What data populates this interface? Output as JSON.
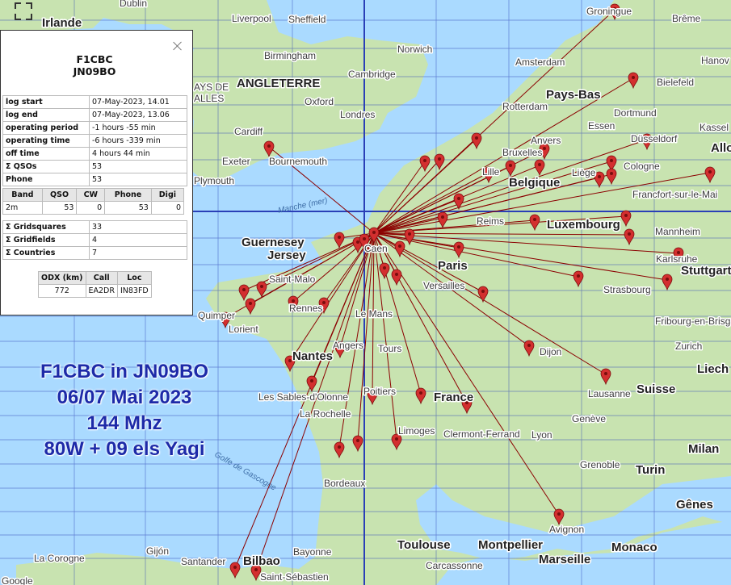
{
  "map": {
    "fullscreen_icon": "fullscreen-icon",
    "marker_color": "#d32f2f",
    "path_color": "#8b0000",
    "grid_color": "#2a3fb7",
    "home_marker": {
      "call": "F1CBC",
      "locator": "JN09BO"
    },
    "labels": {
      "countries": [
        "Pays-Bas",
        "Belgique",
        "Luxembourg",
        "France",
        "Suisse",
        "Monaco",
        "ANGLETERRE",
        "Guernesey",
        "Jersey"
      ],
      "cities": [
        "Dublin",
        "Irlande",
        "Liverpool",
        "Sheffield",
        "Birmingham",
        "Norwich",
        "Cambridge",
        "Oxford",
        "Londres",
        "Cardiff",
        "Exeter",
        "Plymouth",
        "Bournemouth",
        "Amsterdam",
        "Rotterdam",
        "Anvers",
        "Bruxelles",
        "Lille",
        "Liège",
        "Dortmund",
        "Essen",
        "Düsseldorf",
        "Cologne",
        "Bielefeld",
        "Groningue",
        "Brême",
        "Hanov",
        "Kassel",
        "Allo",
        "Francfort-sur-le-Mai",
        "Mannheim",
        "Karlsruhe",
        "Stuttgart",
        "Strasbourg",
        "Fribourg-en-Brisgau",
        "Zurich",
        "Liech",
        "Dijon",
        "Lausanne",
        "Genève",
        "Lyon",
        "Clermont-Ferrand",
        "Grenoble",
        "Turin",
        "Milan",
        "Gênes",
        "Avignon",
        "Marseille",
        "Montpellier",
        "Toulouse",
        "Carcassonne",
        "Bordeaux",
        "Limoges",
        "Poitiers",
        "La Rochelle",
        "Les Sables-d'Olonne",
        "Nantes",
        "Angers",
        "Tours",
        "Le Mans",
        "Rennes",
        "Saint-Malo",
        "Quimper",
        "Lorient",
        "Caen",
        "Paris",
        "Versailles",
        "Reims",
        "Bayonne",
        "Bilbao",
        "Santander",
        "Gijón",
        "La Corogne",
        "Saint-Sébastien",
        "Manche (mer)",
        "Golfe de Gascogne",
        "Google",
        "AYS DE",
        "ALLES"
      ]
    }
  },
  "panel": {
    "close_icon": "close-icon",
    "title_call": "F1CBC",
    "title_loc": "JN09BO",
    "log": [
      {
        "k": "log start",
        "v": "07-May-2023, 14.01"
      },
      {
        "k": "log end",
        "v": "07-May-2023, 13.06"
      },
      {
        "k": "operating period",
        "v": "-1 hours -55 min"
      },
      {
        "k": "operating time",
        "v": "-6 hours -339 min"
      },
      {
        "k": "off time",
        "v": "4 hours 44 min"
      },
      {
        "k": "Σ QSOs",
        "v": "53"
      },
      {
        "k": "Phone",
        "v": "53"
      }
    ],
    "band_headers": [
      "Band",
      "QSO",
      "CW",
      "Phone",
      "Digi"
    ],
    "band_row": [
      "2m",
      "53",
      "0",
      "53",
      "0"
    ],
    "summary": [
      {
        "k": "Σ Gridsquares",
        "v": "33"
      },
      {
        "k": "Σ Gridfields",
        "v": "4"
      },
      {
        "k": "Σ Countries",
        "v": "7"
      }
    ],
    "odx_headers": [
      "ODX (km)",
      "Call",
      "Loc"
    ],
    "odx_row": [
      "772",
      "EA2DR",
      "IN83FD"
    ]
  },
  "info": {
    "line1": "F1CBC in JN09BO",
    "line2": "06/07 Mai 2023",
    "line3": "144 Mhz",
    "line4": "80W + 09 els Yagi"
  }
}
